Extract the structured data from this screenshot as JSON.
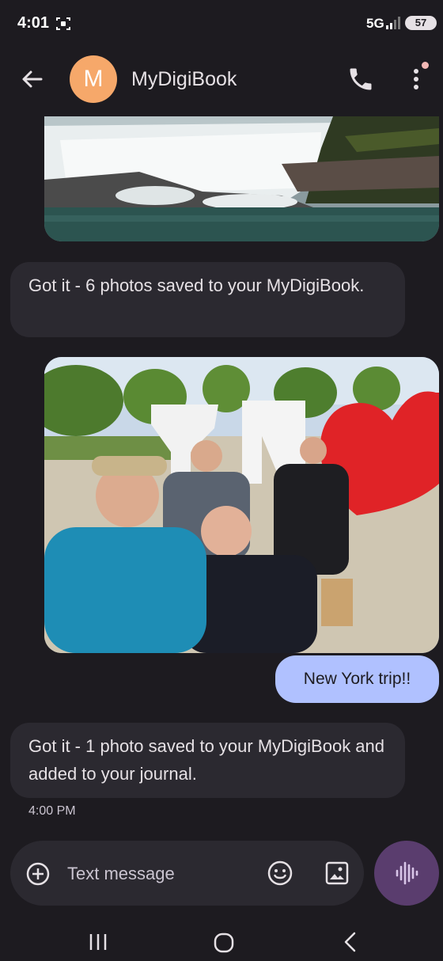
{
  "status_bar": {
    "time": "4:01",
    "network": "5G",
    "battery": "57"
  },
  "app_bar": {
    "avatar_letter": "M",
    "contact_name": "MyDigiBook"
  },
  "conversation": {
    "photo_1_alt": "Waterfall photo",
    "reply_1": "Got it - 6 photos saved to your MyDigiBook.",
    "photo_2_alt": "Group selfie at NY sign",
    "sent_message": "New York trip!!",
    "reply_2": "Got it - 1 photo saved to your MyDigiBook and added to your journal.",
    "timestamp": "4:00 PM"
  },
  "compose": {
    "placeholder": "Text message"
  },
  "colors": {
    "accent_bubble": "#b0c1ff",
    "avatar": "#f6a86a",
    "voice_button": "#5a3d6e",
    "background": "#1d1b20"
  },
  "icons": [
    "back-arrow-icon",
    "phone-icon",
    "more-vert-icon",
    "add-circle-icon",
    "emoji-icon",
    "gallery-icon",
    "voice-wave-icon"
  ]
}
